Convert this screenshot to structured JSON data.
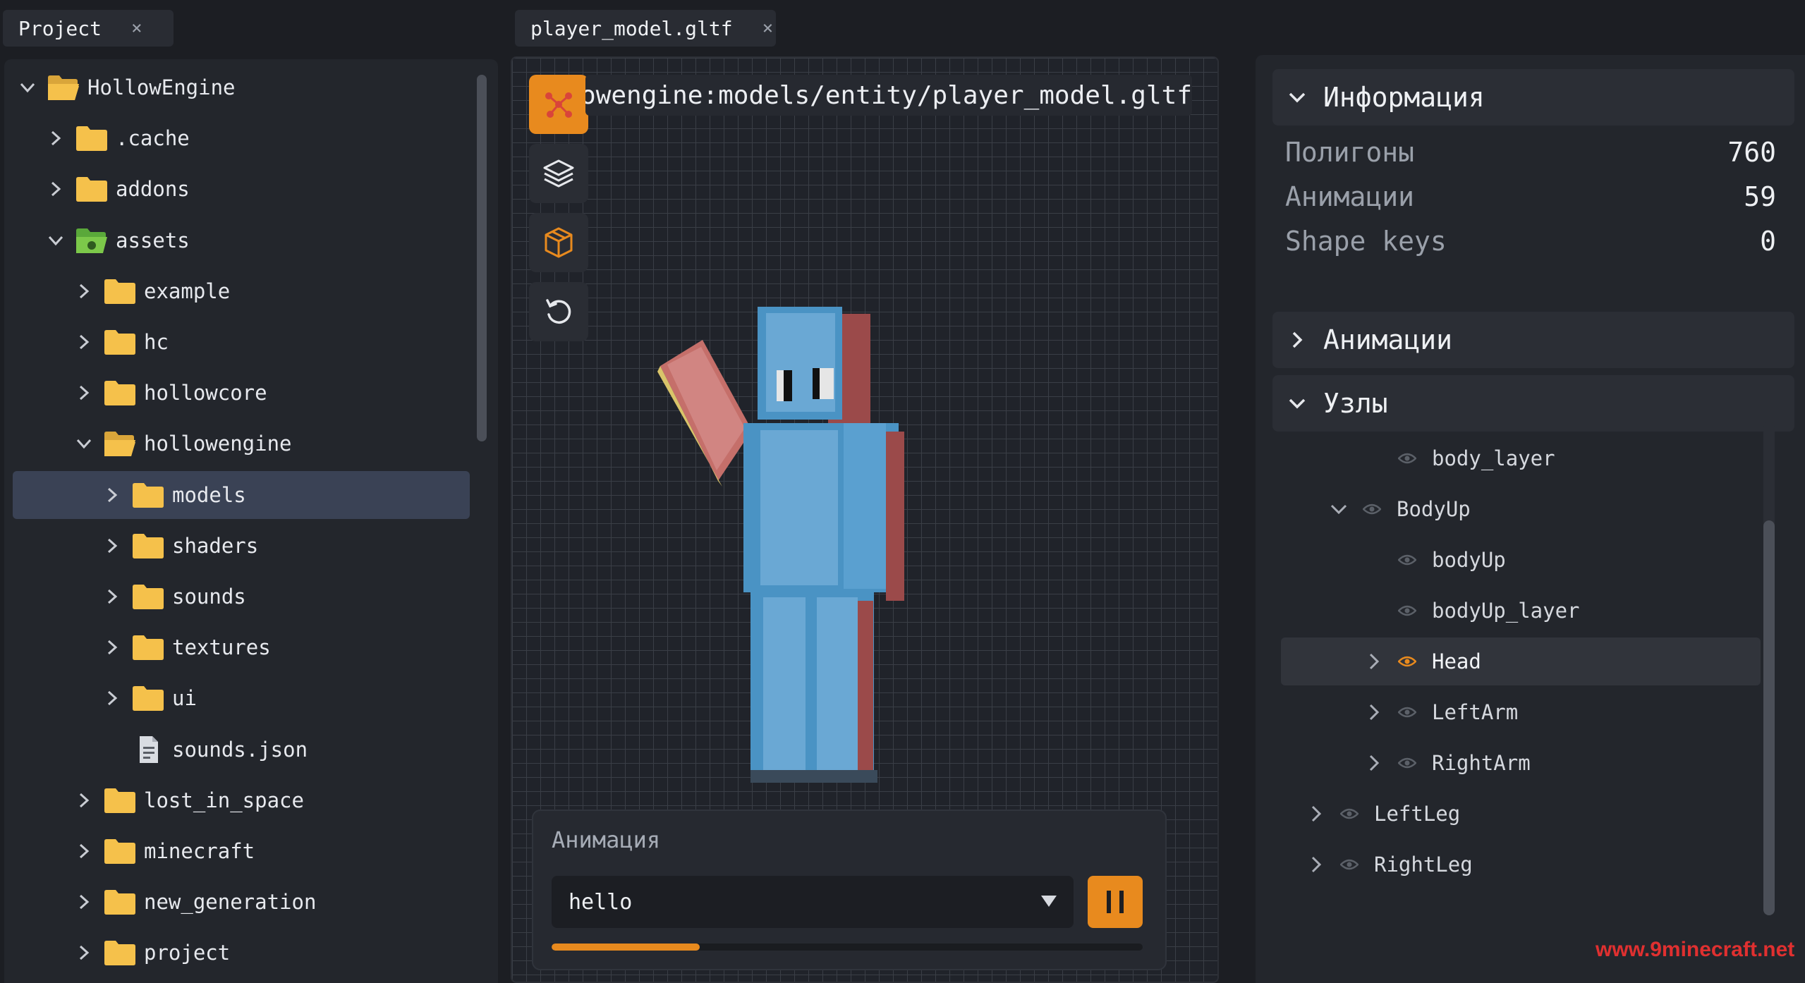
{
  "tabs": {
    "project": {
      "label": "Project",
      "close": "×"
    },
    "editor": {
      "label": "player_model.gltf",
      "close": "×"
    }
  },
  "project_tree": [
    {
      "label": "HollowEngine",
      "expanded": true,
      "icon": "folder-open-icon"
    },
    {
      "label": ".cache",
      "expanded": false,
      "icon": "folder-icon"
    },
    {
      "label": "addons",
      "expanded": false,
      "icon": "folder-icon"
    },
    {
      "label": "assets",
      "expanded": true,
      "icon": "folder-open-special-icon"
    },
    {
      "label": "example",
      "expanded": false,
      "icon": "folder-icon"
    },
    {
      "label": "hc",
      "expanded": false,
      "icon": "folder-icon"
    },
    {
      "label": "hollowcore",
      "expanded": false,
      "icon": "folder-icon"
    },
    {
      "label": "hollowengine",
      "expanded": true,
      "icon": "folder-open-icon"
    },
    {
      "label": "models",
      "expanded": false,
      "icon": "folder-icon",
      "selected": true
    },
    {
      "label": "shaders",
      "expanded": false,
      "icon": "folder-icon"
    },
    {
      "label": "sounds",
      "expanded": false,
      "icon": "folder-icon"
    },
    {
      "label": "textures",
      "expanded": false,
      "icon": "folder-icon"
    },
    {
      "label": "ui",
      "expanded": false,
      "icon": "folder-icon"
    },
    {
      "label": "sounds.json",
      "icon": "file-icon"
    },
    {
      "label": "lost_in_space",
      "expanded": false,
      "icon": "folder-icon"
    },
    {
      "label": "minecraft",
      "expanded": false,
      "icon": "folder-icon"
    },
    {
      "label": "new_generation",
      "expanded": false,
      "icon": "folder-icon"
    },
    {
      "label": "project",
      "expanded": false,
      "icon": "folder-icon"
    }
  ],
  "viewport": {
    "path": "hollowengine:models/entity/player_model.gltf",
    "tools": [
      "bones-icon",
      "layers-icon",
      "cube-icon",
      "reset-icon"
    ]
  },
  "animation_panel": {
    "label": "Анимация",
    "selected": "hello",
    "progress": 0.25
  },
  "info_section": {
    "title": "Информация",
    "rows": [
      {
        "label": "Полигоны",
        "value": "760"
      },
      {
        "label": "Анимации",
        "value": "59"
      },
      {
        "label": "Shape keys",
        "value": "0"
      }
    ]
  },
  "animations_section": {
    "title": "Анимации"
  },
  "nodes_section": {
    "title": "Узлы",
    "nodes": [
      {
        "label": "body_layer"
      },
      {
        "label": "BodyUp",
        "expanded": true
      },
      {
        "label": "bodyUp"
      },
      {
        "label": "bodyUp_layer"
      },
      {
        "label": "Head",
        "expanded": false,
        "selected": true
      },
      {
        "label": "LeftArm",
        "expanded": false
      },
      {
        "label": "RightArm",
        "expanded": false
      },
      {
        "label": "LeftLeg",
        "expanded": false
      },
      {
        "label": "RightLeg",
        "expanded": false
      }
    ]
  },
  "colors": {
    "accent": "#e88a1e",
    "folder": "#f5c14b",
    "selection": "#3a4255"
  },
  "watermark": "www.9minecraft.net"
}
